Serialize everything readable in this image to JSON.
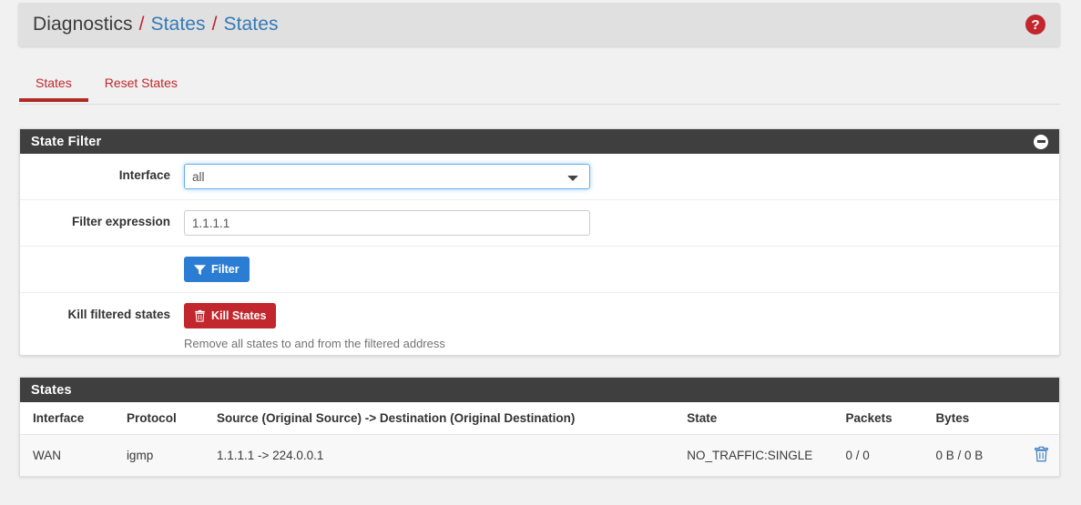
{
  "breadcrumb": {
    "root": "Diagnostics",
    "separator": "/",
    "level1": "States",
    "level2": "States",
    "help_icon": "help-circle-icon",
    "help_glyph": "?"
  },
  "tabs": [
    {
      "label": "States",
      "active": true
    },
    {
      "label": "Reset States",
      "active": false
    }
  ],
  "filter_panel": {
    "title": "State Filter",
    "collapse_icon": "minus-circle-icon",
    "interface": {
      "label": "Interface",
      "value": "all",
      "options": [
        "all"
      ]
    },
    "filter_expression": {
      "label": "Filter expression",
      "value": "1.1.1.1",
      "placeholder": ""
    },
    "filter_button": {
      "label": "Filter",
      "icon": "funnel-icon",
      "color": "#2b7cd3"
    },
    "kill_states": {
      "label": "Kill filtered states",
      "button_label": "Kill States",
      "icon": "trash-icon",
      "color": "#c1272d",
      "help_text": "Remove all states to and from the filtered address"
    }
  },
  "states_panel": {
    "title": "States",
    "columns": [
      "Interface",
      "Protocol",
      "Source (Original Source) -> Destination (Original Destination)",
      "State",
      "Packets",
      "Bytes",
      ""
    ],
    "rows": [
      {
        "interface": "WAN",
        "protocol": "igmp",
        "source_destination": "1.1.1.1 -> 224.0.0.1",
        "state": "NO_TRAFFIC:SINGLE",
        "packets": "0 / 0",
        "bytes": "0 B / 0 B",
        "action_icon": "trash-icon"
      }
    ]
  },
  "colors": {
    "accent_red": "#c1272d",
    "link_blue": "#337ab7",
    "primary_blue": "#2b7cd3",
    "panel_header": "#3f3f3f",
    "page_bg": "#f1f1f1",
    "row_action_blue": "#4a89c8"
  }
}
